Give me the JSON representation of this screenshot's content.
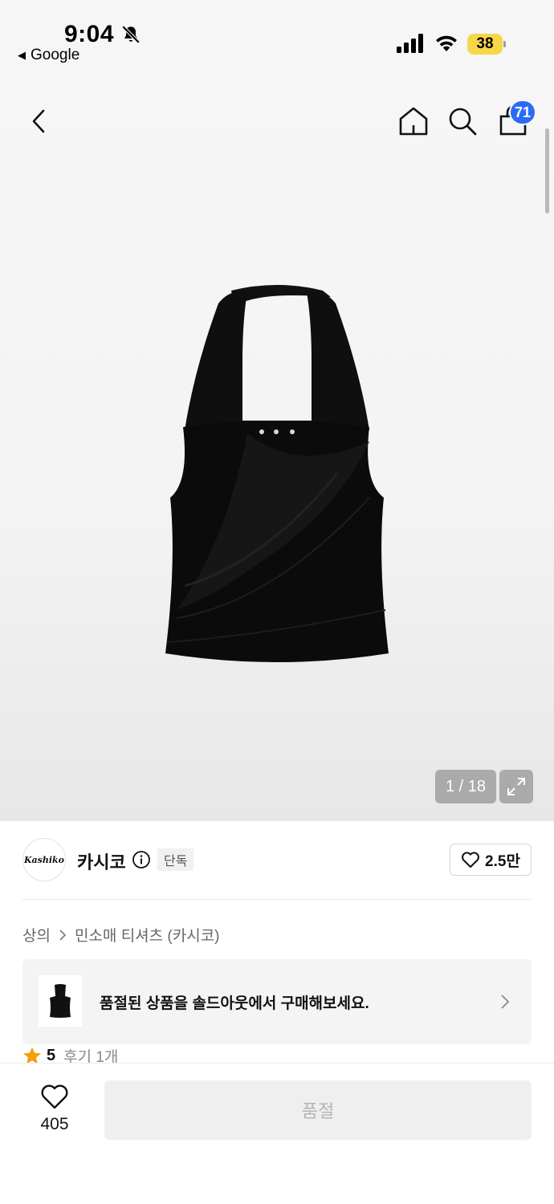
{
  "status_bar": {
    "time": "9:04",
    "back_app": "Google",
    "battery": "38"
  },
  "nav": {
    "cart_count": "71"
  },
  "gallery": {
    "counter": "1 / 18"
  },
  "brand": {
    "logo_text": "Kashiko",
    "name": "카시코",
    "badge": "단독",
    "likes": "2.5만"
  },
  "breadcrumb": {
    "category": "상의",
    "subcategory": "민소매 티셔츠 (카시코)"
  },
  "soldout_banner": {
    "text": "품절된 상품을 솔드아웃에서 구매해보세요."
  },
  "rating": {
    "score": "5",
    "reviews": "후기 1개"
  },
  "bottom_bar": {
    "wish_count": "405",
    "buy_button": "품절"
  },
  "colors": {
    "badge_blue": "#2b6cf6",
    "battery_yellow": "#f7d64a",
    "star_orange": "#f59e0b"
  }
}
